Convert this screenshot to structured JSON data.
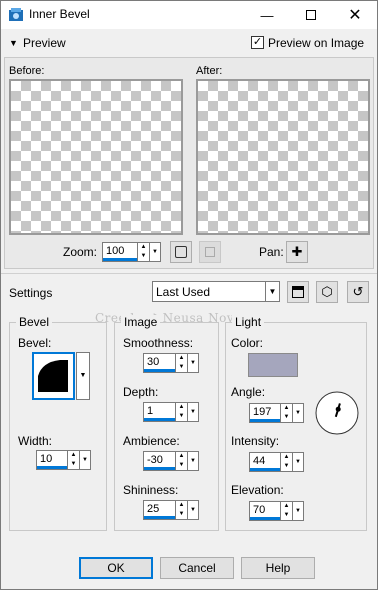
{
  "window": {
    "title": "Inner Bevel",
    "minimize_icon": "minimize-icon",
    "maximize_icon": "maximize-icon",
    "close_icon": "close-icon"
  },
  "preview": {
    "section_label": "Preview",
    "preview_on_image_label": "Preview on Image",
    "preview_on_image_checked": true,
    "before_label": "Before:",
    "after_label": "After:",
    "zoom_label": "Zoom:",
    "zoom_value": "100",
    "pan_label": "Pan:"
  },
  "settings": {
    "label": "Settings",
    "preset_value": "Last Used",
    "watermark": "Cree by ♪ Neusa Novaes"
  },
  "bevel": {
    "group_title": "Bevel",
    "bevel_label": "Bevel:",
    "width_label": "Width:",
    "width_value": "10"
  },
  "image": {
    "group_title": "Image",
    "smoothness_label": "Smoothness:",
    "smoothness_value": "30",
    "depth_label": "Depth:",
    "depth_value": "1",
    "ambience_label": "Ambience:",
    "ambience_value": "-30",
    "shininess_label": "Shininess:",
    "shininess_value": "25"
  },
  "light": {
    "group_title": "Light",
    "color_label": "Color:",
    "color_value": "#a5a6bd",
    "angle_label": "Angle:",
    "angle_value": "197",
    "intensity_label": "Intensity:",
    "intensity_value": "44",
    "elevation_label": "Elevation:",
    "elevation_value": "70"
  },
  "buttons": {
    "ok": "OK",
    "cancel": "Cancel",
    "help": "Help"
  },
  "colors": {
    "accent": "#0078d7",
    "title_icon": "#1e6fb8"
  }
}
